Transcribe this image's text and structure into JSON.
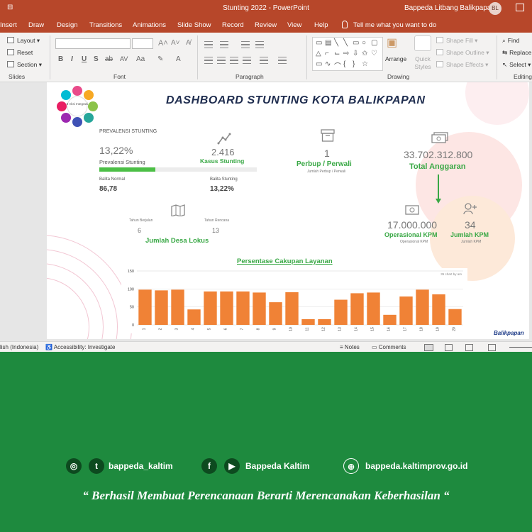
{
  "window": {
    "title": "Stunting 2022  -  PowerPoint",
    "user_name": "Bappeda Litbang Balikpapan",
    "user_initials": "BL"
  },
  "ribbon_tabs": [
    "Insert",
    "Draw",
    "Design",
    "Transitions",
    "Animations",
    "Slide Show",
    "Record",
    "Review",
    "View",
    "Help"
  ],
  "tell_me": "Tell me what you want to do",
  "ribbon": {
    "slides": {
      "layout": "Layout",
      "reset": "Reset",
      "section": "Section",
      "label": "Slides"
    },
    "font": {
      "label": "Font"
    },
    "paragraph": {
      "label": "Paragraph"
    },
    "drawing": {
      "arrange": "Arrange",
      "quick_styles": "Quick Styles",
      "shape_fill": "Shape Fill",
      "shape_outline": "Shape Outline",
      "shape_effects": "Shape Effects",
      "label": "Drawing"
    },
    "editing": {
      "find": "Find",
      "replace": "Replace",
      "select": "Select",
      "label": "Editing"
    }
  },
  "slide": {
    "title": "DASHBOARD STUNTING KOTA BALIKPAPAN",
    "logo_text": "8 Aksi Integrasi",
    "prevalensi": {
      "header": "PREVALENSI STUNTING",
      "value": "13,22%",
      "label": "Prevalensi Stunting",
      "progress": 0.1322
    },
    "kasus": {
      "value": "2.416",
      "label": "Kasus Stunting"
    },
    "balita_normal": {
      "label": "Balita Normal",
      "value": "86,78"
    },
    "balita_stunting": {
      "label": "Balita Stunting",
      "value": "13,22%"
    },
    "desa": {
      "label": "Jumlah Desa Lokus",
      "tahun_sebelum_label": "Tahun Berjalan",
      "tahun_sebelum_value": "6",
      "tahun_berikut_label": "Tahun Rencana",
      "tahun_berikut_value": "13"
    },
    "perbup": {
      "value": "1",
      "label": "Perbup / Perwali",
      "sub": "Jumlah Perbup / Perwali"
    },
    "anggaran": {
      "value": "33.702.312.800",
      "label": "Total Anggaran"
    },
    "operasional": {
      "value": "17.000.000",
      "label": "Operasional KPM",
      "sub": "Operasional KPM"
    },
    "kpm": {
      "value": "34",
      "label": "Jumlah KPM",
      "sub": "Jumlah KPM"
    },
    "chart_title": "Persentase Cakupan Layanan",
    "brand": "Balikpapan"
  },
  "chart_data": {
    "type": "bar",
    "categories": [
      "1",
      "2",
      "3",
      "4",
      "5",
      "6",
      "7",
      "8",
      "9",
      "10",
      "11",
      "12",
      "13",
      "14",
      "15",
      "16",
      "17",
      "18",
      "19",
      "20"
    ],
    "values": [
      98,
      96,
      98,
      43,
      93,
      93,
      93,
      90,
      63,
      91,
      16,
      16,
      70,
      88,
      90,
      28,
      79,
      98,
      85,
      44
    ],
    "ylim": [
      0,
      150
    ],
    "yticks": [
      "0",
      "25",
      "50",
      "75",
      "100",
      "125",
      "150"
    ],
    "annotation": "35 chart by am",
    "color": "#f08236"
  },
  "statusbar": {
    "language": "lish (Indonesia)",
    "accessibility": "Accessibility: Investigate",
    "notes": "Notes",
    "comments": "Comments"
  },
  "footer": {
    "handle": "bappeda_kaltim",
    "social_name": "Bappeda Kaltim",
    "website": "bappeda.kaltimprov.go.id",
    "motto": "“ Berhasil  Membuat Perencanaan Berarti Merencanakan Keberhasilan “"
  },
  "colors": {
    "accent": "#b7472a",
    "footer_green": "#1e8a3e",
    "label_green": "#39a845",
    "bar": "#f08236"
  }
}
